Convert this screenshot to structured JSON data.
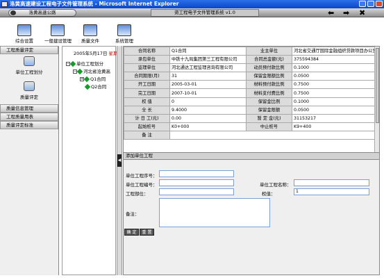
{
  "window": {
    "title": "洛黄高速建设工程电子文件管理系统 - Microsoft Internet Explorer"
  },
  "header": {
    "company": "洛黄高速公路",
    "system_title": "资工程电子文件管理系统 v1.0"
  },
  "toolbar": {
    "items": [
      {
        "label": "综合设置",
        "icon": "settings-chart-icon"
      },
      {
        "label": "一般建设管理",
        "icon": "people-icon"
      },
      {
        "label": "质量文件",
        "icon": "document-icon"
      },
      {
        "label": "系统管理",
        "icon": "computer-icon"
      }
    ]
  },
  "leftnav": {
    "section_quality": "工程质量评定",
    "unit_division": "单位工程划分",
    "quality_eval": "质量评定",
    "info_mgmt": "质量信息管理",
    "quality_form": "工程质量用表",
    "eval_standard": "质量评定标准"
  },
  "tree": {
    "date": "2005年5月17日",
    "weekday": "星期",
    "root": "单位工程划分",
    "child": "河北省沧黄高",
    "contracts": [
      "Q1合同",
      "Q2合同"
    ]
  },
  "info": {
    "rows": [
      [
        "合同名称",
        "Q1合同",
        "业主单位",
        "河北省交通厅国际金融组织贷款项目办公室"
      ],
      [
        "承包单位",
        "中铁十九局集团第三工程有限公司",
        "合同总金额(元)",
        "375594384"
      ],
      [
        "监理单位",
        "河北通达工程监理咨询有限公司",
        "动员预付款比例",
        "0.1000"
      ],
      [
        "合同期限(月)",
        "31",
        "保留金限额比例",
        "0.0500"
      ],
      [
        "开工日期",
        "2005-03-01",
        "材料预付款比例",
        "0.7500"
      ],
      [
        "完工日期",
        "2007-10-01",
        "材料支付费比例",
        "0.7500"
      ],
      [
        "权    值",
        "0",
        "保留金比例",
        "0.1000"
      ],
      [
        "全    长",
        "9.4000",
        "保留金限额",
        "0.0500"
      ],
      [
        "计 日 工(元)",
        "0.00",
        "暂 定 金(元)",
        "31153217"
      ],
      [
        "起始桩号",
        "K0+000",
        "中止桩号",
        "K9+400"
      ],
      [
        "备    注",
        "",
        "",
        ""
      ]
    ]
  },
  "form": {
    "title": "添加单位工程",
    "seq_label": "单位工程序号：",
    "code_label": "单位工程编号：",
    "name_label": "单位工程名称：",
    "part_label": "工程部位：",
    "weight_label": "权值：",
    "weight_value": "1",
    "remark_label": "备注：",
    "ok_button": "确 定",
    "reset_button": "重 置"
  }
}
